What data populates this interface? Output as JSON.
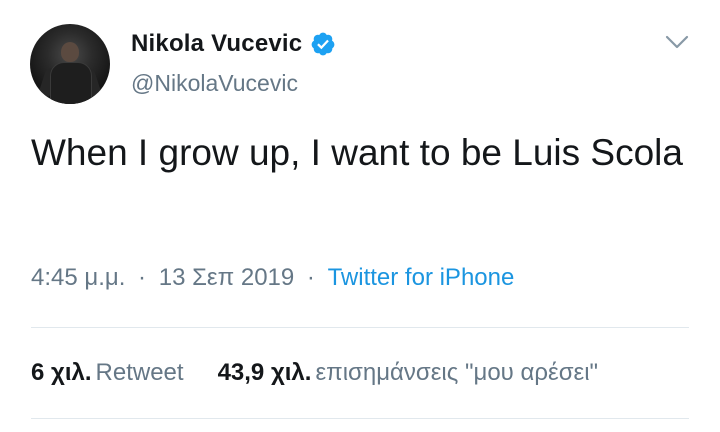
{
  "author": {
    "display_name": "Nikola Vucevic",
    "handle": "@NikolaVucevic",
    "verified": true,
    "avatar_icon": "profile-photo"
  },
  "tweet": {
    "text": "When I grow up, I want to be Luis Scola",
    "time": "4:45 μ.μ.",
    "date": "13 Σεπ 2019",
    "separator": "·",
    "source": "Twitter for iPhone"
  },
  "stats": {
    "retweets_count": "6 χιλ.",
    "retweets_label": "Retweet",
    "likes_count": "43,9 χιλ.",
    "likes_label": "επισημάνσεις \"μου αρέσει\""
  },
  "colors": {
    "text": "#14171a",
    "secondary": "#657786",
    "link": "#1b95e0",
    "verified": "#1da1f2",
    "divider": "#e1e8ed"
  },
  "icons": {
    "verified": "verified-badge-icon",
    "menu": "chevron-down-icon"
  }
}
